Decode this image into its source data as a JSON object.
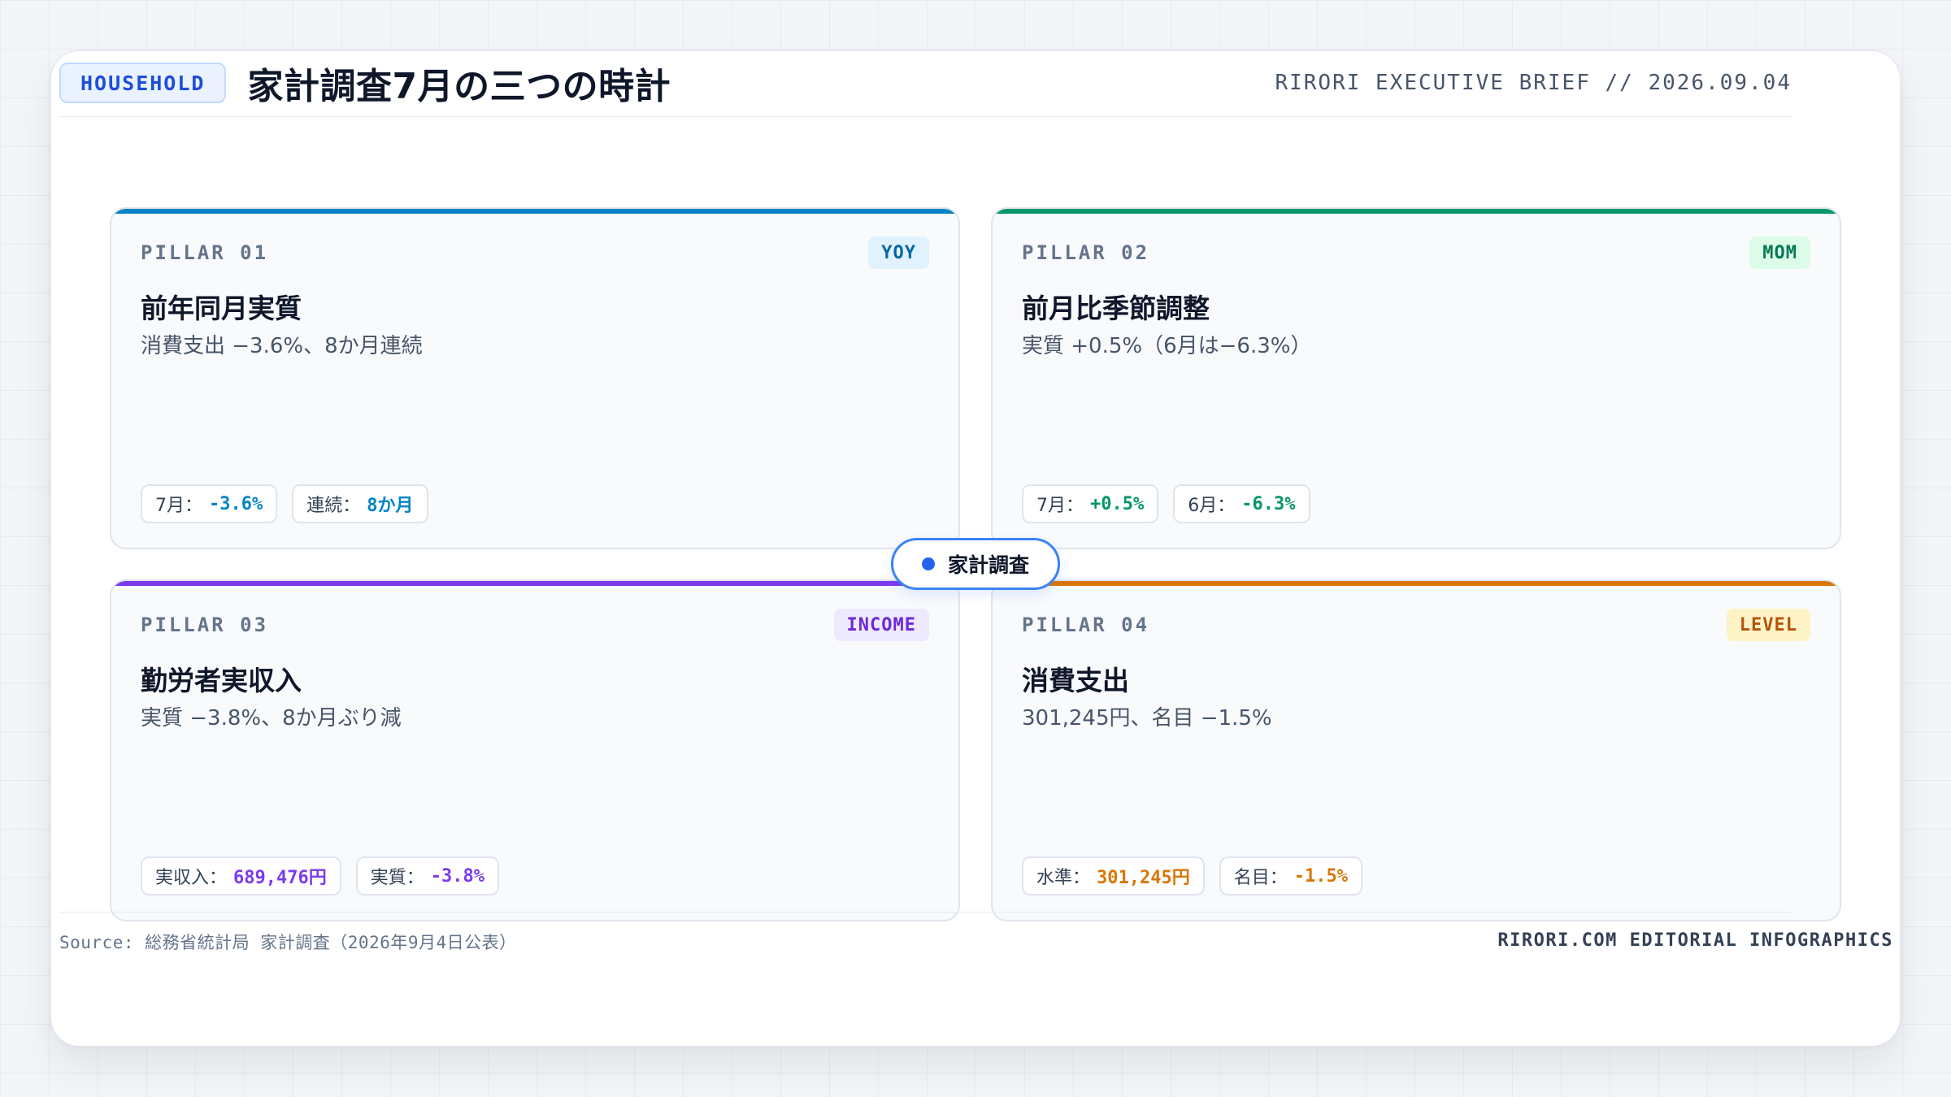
{
  "header": {
    "badge": "HOUSEHOLD",
    "title": "家計調査7月の三つの時計",
    "brief": "RIRORI EXECUTIVE BRIEF // 2026.09.04"
  },
  "hub": {
    "label": "家計調査",
    "color": "#2563eb"
  },
  "pillars": [
    {
      "label": "PILLAR 01",
      "tag": "YOY",
      "title": "前年同月実質",
      "desc": "消費支出 −3.6%、8か月連続",
      "accent": "#0284c7",
      "chips": [
        {
          "label": "7月",
          "value": "-3.6%"
        },
        {
          "label": "連続",
          "value": "8か月"
        }
      ]
    },
    {
      "label": "PILLAR 02",
      "tag": "MOM",
      "title": "前月比季節調整",
      "desc": "実質 +0.5%（6月は−6.3%）",
      "accent": "#059669",
      "chips": [
        {
          "label": "7月",
          "value": "+0.5%"
        },
        {
          "label": "6月",
          "value": "-6.3%"
        }
      ]
    },
    {
      "label": "PILLAR 03",
      "tag": "INCOME",
      "title": "勤労者実収入",
      "desc": "実質 −3.8%、8か月ぶり減",
      "accent": "#7c3aed",
      "chips": [
        {
          "label": "実収入",
          "value": "689,476円"
        },
        {
          "label": "実質",
          "value": "-3.8%"
        }
      ]
    },
    {
      "label": "PILLAR 04",
      "tag": "LEVEL",
      "title": "消費支出",
      "desc": "301,245円、名目 −1.5%",
      "accent": "#d97706",
      "chips": [
        {
          "label": "水準",
          "value": "301,245円"
        },
        {
          "label": "名目",
          "value": "-1.5%"
        }
      ]
    }
  ],
  "footer": {
    "source": "Source: 総務省統計局 家計調査（2026年9月4日公表）",
    "brand": "RIRORI.COM EDITORIAL INFOGRAPHICS"
  }
}
